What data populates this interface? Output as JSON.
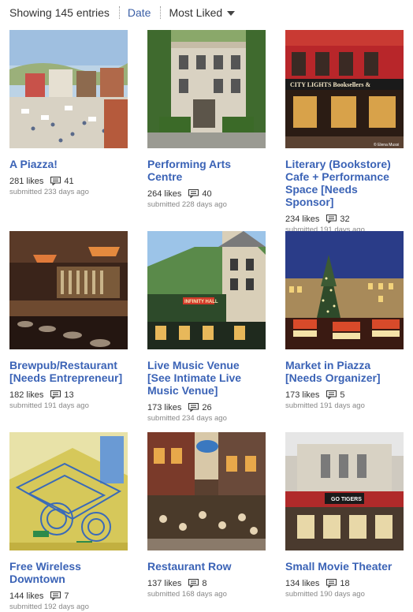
{
  "header": {
    "entries_label": "Showing 145 entries",
    "sort_date": "Date",
    "sort_liked": "Most Liked"
  },
  "entries": [
    {
      "title": "A Piazza!",
      "likes": "281 likes",
      "comments": "41",
      "submitted": "submitted 233 days ago"
    },
    {
      "title": "Performing Arts Centre",
      "likes": "264 likes",
      "comments": "40",
      "submitted": "submitted 228 days ago"
    },
    {
      "title": "Literary (Bookstore) Cafe + Performance Space [Needs Sponsor]",
      "likes": "234 likes",
      "comments": "32",
      "submitted": "submitted 191 days ago",
      "sign": "CITY LIGHTS Booksellers &",
      "credit": "© Elena Mussi"
    },
    {
      "title": "Brewpub/Restaurant [Needs Entrepreneur]",
      "likes": "182 likes",
      "comments": "13",
      "submitted": "submitted 191 days ago"
    },
    {
      "title": "Live Music Venue [See Intimate Live Music Venue]",
      "likes": "173 likes",
      "comments": "26",
      "submitted": "submitted 234 days ago",
      "sign": "INFINITY HALL"
    },
    {
      "title": "Market in Piazza [Needs Organizer]",
      "likes": "173 likes",
      "comments": "5",
      "submitted": "submitted 191 days ago"
    },
    {
      "title": "Free Wireless Downtown",
      "likes": "144 likes",
      "comments": "7",
      "submitted": "submitted 192 days ago"
    },
    {
      "title": "Restaurant Row",
      "likes": "137 likes",
      "comments": "8",
      "submitted": "submitted 168 days ago"
    },
    {
      "title": "Small Movie Theater",
      "likes": "134 likes",
      "comments": "18",
      "submitted": "submitted 190 days ago",
      "sign": "GO TIGERS"
    }
  ],
  "colors": {
    "link": "#3b63b6",
    "muted": "#888888"
  }
}
